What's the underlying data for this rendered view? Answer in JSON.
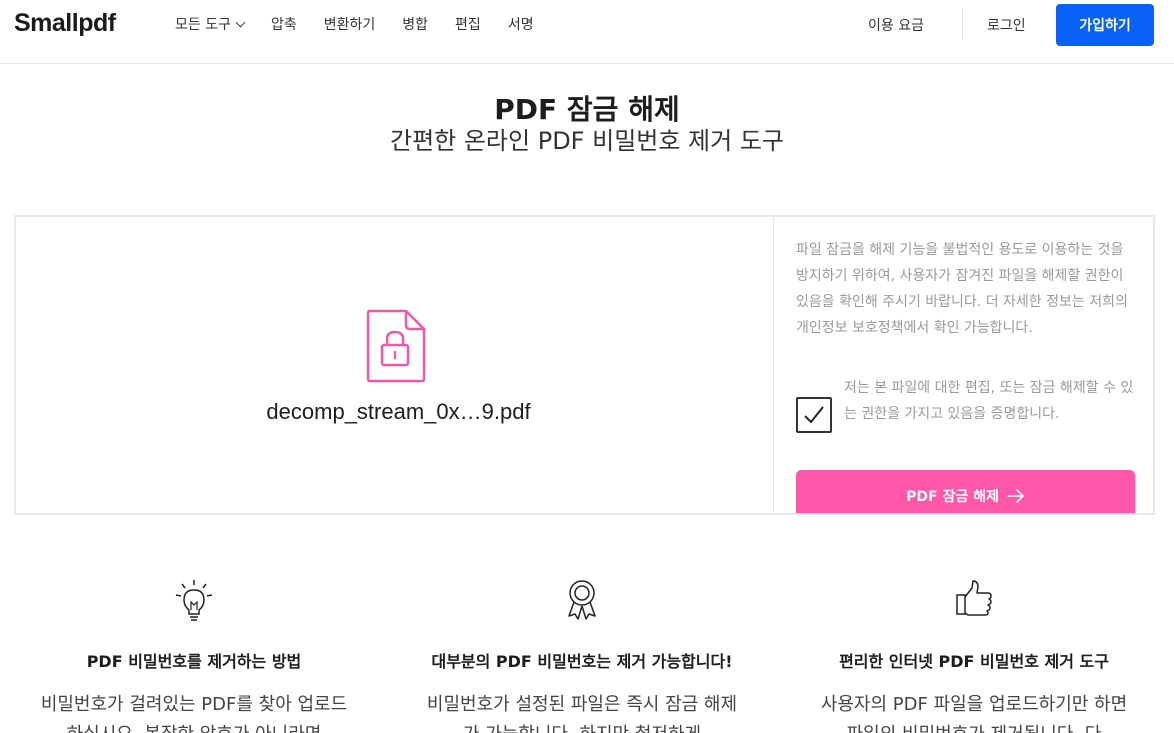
{
  "header": {
    "logo": "Smallpdf",
    "nav": [
      "모든 도구",
      "압축",
      "변환하기",
      "병합",
      "편집",
      "서명"
    ],
    "pricing": "이용 요금",
    "login": "로그인",
    "signup": "가입하기"
  },
  "hero": {
    "title": "PDF 잠금 해제",
    "subtitle": "간편한 온라인 PDF 비밀번호 제거 도구"
  },
  "tool": {
    "file_name": "decomp_stream_0x…9.pdf",
    "notice": "파일 잠금을 해제 기능을 불법적인 용도로 이용하는 것을 방지하기 위하여, 사용자가 잠겨진 파일을 해제할 권한이 있음을 확인해 주시기 바랍니다. 더 자세한 정보는 저희의 개인정보 보호정책에서 확인 가능합니다.",
    "checkbox_label": "저는 본 파일에 대한 편집, 또는 잠금 해제할 수 있는 권한을 가지고 있음을 증명합니다.",
    "checkbox_checked": true,
    "unlock_button": "PDF 잠금 해제",
    "accent_color": "#ff57a8"
  },
  "features": [
    {
      "icon": "lightbulb-icon",
      "title": "PDF 비밀번호를 제거하는 방법",
      "body": "비밀번호가 걸려있는 PDF를 찾아 업로드하십시오. 복잡한 암호가 아니라면"
    },
    {
      "icon": "award-icon",
      "title": "대부분의 PDF 비밀번호는 제거 가능합니다!",
      "body": "비밀번호가 설정된 파일은 즉시 잠금 해제가 가능합니다. 하지만 철저하게"
    },
    {
      "icon": "thumbs-up-icon",
      "title": "편리한 인터넷 PDF 비밀번호 제거 도구",
      "body": "사용자의 PDF 파일을 업로드하기만 하면 파일의 비밀번호가 제거됩니다. 다"
    }
  ]
}
